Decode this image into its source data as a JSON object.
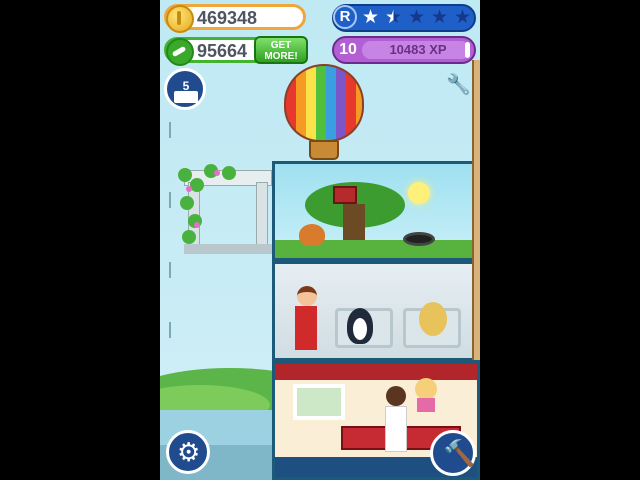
{
  "hud": {
    "coins": "469348",
    "bones": "95664",
    "get_more_label": "GET MORE!",
    "rating_badge": "R",
    "rating_stars": 1.5,
    "rating_max": 5,
    "level": "10",
    "xp": "10483 XP",
    "xp_progress": 0.96
  },
  "quest_book": {
    "count": "5"
  },
  "icons": {
    "coin": "coin-icon",
    "bone": "bone-icon",
    "settings": "gear-icon",
    "build": "hammer-icon",
    "repair": "wrench-icon",
    "quests": "book-icon"
  },
  "colors": {
    "coins_border": "#f0a73a",
    "bones_border": "#44b334",
    "rating_bg": "#1f60c8",
    "level_bg": "#b15fd3",
    "button_bg": "#204c8f"
  }
}
